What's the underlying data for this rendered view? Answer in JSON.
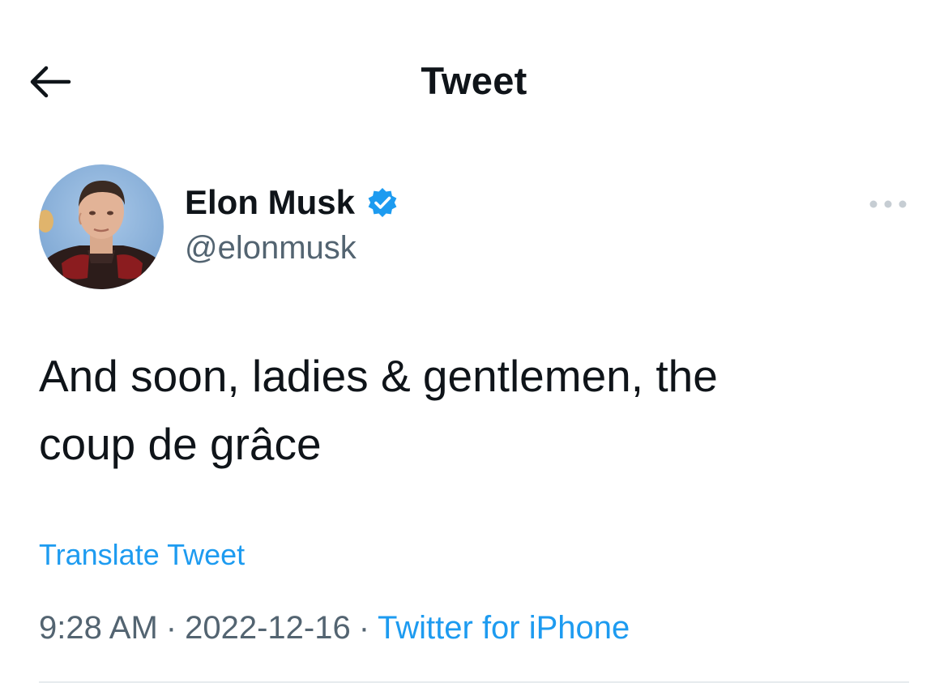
{
  "header": {
    "title": "Tweet",
    "back_icon": "arrow-left-icon"
  },
  "author": {
    "name": "Elon Musk",
    "handle": "@elonmusk",
    "verified_icon": "verified-badge-icon",
    "avatar": "profile-photo"
  },
  "more_icon": "more-horizontal-icon",
  "tweet": {
    "text_line1": "And soon, ladies & gentlemen, the",
    "text_line2": "coup de grâce",
    "translate_label": "Translate Tweet",
    "time": "9:28 AM",
    "separator": "·",
    "date": "2022-12-16",
    "source": "Twitter for iPhone"
  },
  "colors": {
    "accent": "#1d9bf0",
    "text": "#0f1419",
    "secondary_text": "#536471",
    "divider": "#e6ebee"
  }
}
